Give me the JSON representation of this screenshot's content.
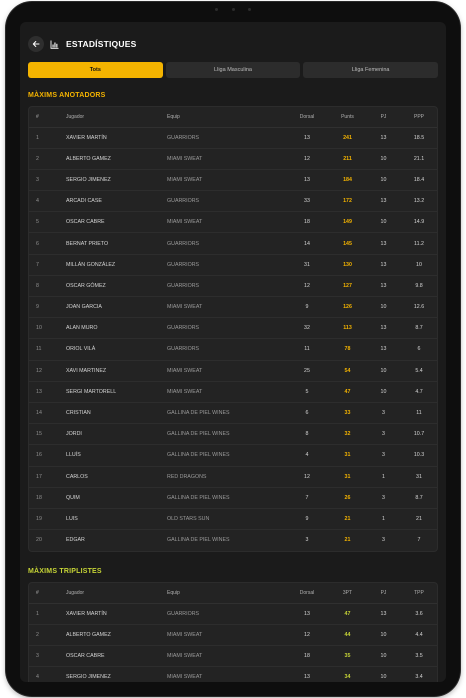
{
  "header": {
    "title": "ESTADÍSTIQUES"
  },
  "tabs": [
    {
      "label": "Tots",
      "active": true
    },
    {
      "label": "Lliga Masculina",
      "active": false
    },
    {
      "label": "Lliga Femenina",
      "active": false
    }
  ],
  "colors": {
    "accent": "#f5b400",
    "accent_green": "#c6d436",
    "background": "#1b1b1b"
  },
  "scorers": {
    "title": "MÀXIMS ANOTADORS",
    "columns": [
      "#",
      "Jugador",
      "Equip",
      "Dorsal",
      "Punts",
      "PJ",
      "PPP"
    ],
    "rows": [
      [
        "1",
        "XAVIER MARTÍN",
        "GUARRIORS",
        "13",
        "241",
        "13",
        "18.5"
      ],
      [
        "2",
        "ALBERTO GAMEZ",
        "MIAMI SWEAT",
        "12",
        "211",
        "10",
        "21.1"
      ],
      [
        "3",
        "SERGIO JIMENEZ",
        "MIAMI SWEAT",
        "13",
        "184",
        "10",
        "18.4"
      ],
      [
        "4",
        "ARCADI CASE",
        "GUARRIORS",
        "33",
        "172",
        "13",
        "13.2"
      ],
      [
        "5",
        "OSCAR CABRE",
        "MIAMI SWEAT",
        "18",
        "149",
        "10",
        "14.9"
      ],
      [
        "6",
        "BERNAT PRIETO",
        "GUARRIORS",
        "14",
        "145",
        "13",
        "11.2"
      ],
      [
        "7",
        "MILLÁN GONZÁLEZ",
        "GUARRIORS",
        "31",
        "130",
        "13",
        "10"
      ],
      [
        "8",
        "OSCAR GÓMEZ",
        "GUARRIORS",
        "12",
        "127",
        "13",
        "9.8"
      ],
      [
        "9",
        "JOAN GARCIA",
        "MIAMI SWEAT",
        "9",
        "126",
        "10",
        "12.6"
      ],
      [
        "10",
        "ALAN MURO",
        "GUARRIORS",
        "32",
        "113",
        "13",
        "8.7"
      ],
      [
        "11",
        "ORIOL VILÀ",
        "GUARRIORS",
        "11",
        "78",
        "13",
        "6"
      ],
      [
        "12",
        "XAVI MARTINEZ",
        "MIAMI SWEAT",
        "25",
        "54",
        "10",
        "5.4"
      ],
      [
        "13",
        "SERGI MARTORELL",
        "MIAMI SWEAT",
        "5",
        "47",
        "10",
        "4.7"
      ],
      [
        "14",
        "CRISTIAN",
        "GALLINA DE PIEL WINES",
        "6",
        "33",
        "3",
        "11"
      ],
      [
        "15",
        "JORDI",
        "GALLINA DE PIEL WINES",
        "8",
        "32",
        "3",
        "10.7"
      ],
      [
        "16",
        "LLUÍS",
        "GALLINA DE PIEL WINES",
        "4",
        "31",
        "3",
        "10.3"
      ],
      [
        "17",
        "CARLOS",
        "RED DRAGONS",
        "12",
        "31",
        "1",
        "31"
      ],
      [
        "18",
        "QUIM",
        "GALLINA DE PIEL WINES",
        "7",
        "26",
        "3",
        "8.7"
      ],
      [
        "19",
        "LUIS",
        "OLD STARS SUN",
        "9",
        "21",
        "1",
        "21"
      ],
      [
        "20",
        "EDGAR",
        "GALLINA DE PIEL WINES",
        "3",
        "21",
        "3",
        "7"
      ]
    ]
  },
  "triples": {
    "title": "MÀXIMS TRIPLISTES",
    "columns": [
      "#",
      "Jugador",
      "Equip",
      "Dorsal",
      "3PT",
      "PJ",
      "TPP"
    ],
    "rows": [
      [
        "1",
        "XAVIER MARTÍN",
        "GUARRIORS",
        "13",
        "47",
        "13",
        "3.6"
      ],
      [
        "2",
        "ALBERTO GAMEZ",
        "MIAMI SWEAT",
        "12",
        "44",
        "10",
        "4.4"
      ],
      [
        "3",
        "OSCAR CABRE",
        "MIAMI SWEAT",
        "18",
        "35",
        "10",
        "3.5"
      ],
      [
        "4",
        "SERGIO JIMENEZ",
        "MIAMI SWEAT",
        "13",
        "34",
        "10",
        "3.4"
      ]
    ]
  }
}
